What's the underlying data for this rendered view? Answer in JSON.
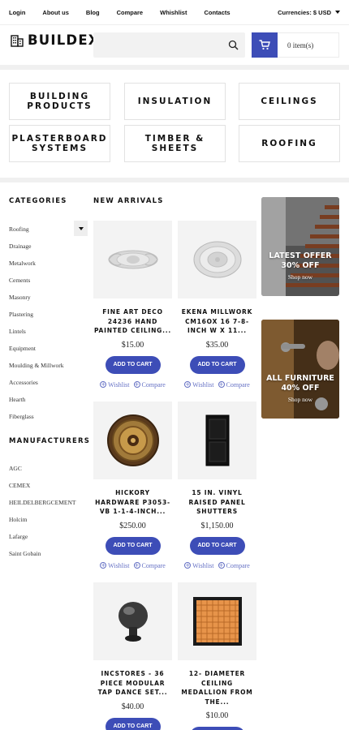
{
  "topbar": {
    "links": [
      "Login",
      "About us",
      "Blog",
      "Compare",
      "Whishlist",
      "Contacts"
    ],
    "currency_label": "Currencies: $ USD"
  },
  "header": {
    "logo_text": "BUILDEX",
    "search_placeholder": "",
    "cart_count": "0 item(s)"
  },
  "top_categories": [
    {
      "line1": "BUILDING",
      "line2": "PRODUCTS"
    },
    {
      "line1": "INSULATION",
      "line2": ""
    },
    {
      "line1": "CEILINGS",
      "line2": ""
    },
    {
      "line1": "PLASTERBOARD",
      "line2": "SYSTEMS"
    },
    {
      "line1": "TIMBER &",
      "line2": "SHEETS"
    },
    {
      "line1": "ROOFING",
      "line2": ""
    }
  ],
  "sidebar": {
    "categories_title": "CATEGORIES",
    "categories": [
      "Roofing",
      "Drainage",
      "Metalwork",
      "Cements",
      "Masonry",
      "Plastering",
      "Lintels",
      "Equipment",
      "Moulding & Millwork",
      "Accessories",
      "Hearth",
      "Fiberglass"
    ],
    "manufacturers_title": "MANUFACTURERS",
    "manufacturers": [
      "AGC",
      "CEMEX",
      "HEILDELBERGCEMENT",
      "Holcim",
      "Lafarge",
      "Saint Gobain"
    ]
  },
  "main": {
    "title": "NEW ARRIVALS",
    "add_label": "ADD TO CART",
    "wishlist_label": "Wishlist",
    "compare_label": "Compare",
    "products": [
      {
        "name": "FINE ART DECO 24236 HAND PAINTED CEILING...",
        "price": "$15.00",
        "icon": "ceiling-medallion-oval"
      },
      {
        "name": "EKENA MILLWORK CM16OX 16 7-8-INCH W X 11...",
        "price": "$35.00",
        "icon": "ceiling-medallion-round"
      },
      {
        "name": "HICKORY HARDWARE P3053-VB 1-1-4-INCH...",
        "price": "$250.00",
        "icon": "ornate-medallion"
      },
      {
        "name": "15 IN. VINYL RAISED PANEL SHUTTERS",
        "price": "$1,150.00",
        "icon": "panel-shutter"
      },
      {
        "name": "INCSTORES - 36 PIECE MODULAR TAP DANCE SET...",
        "price": "$40.00",
        "icon": "cabinet-knob"
      },
      {
        "name": "12- DIAMETER CEILING MEDALLION FROM THE...",
        "price": "$10.00",
        "icon": "woven-tile"
      }
    ]
  },
  "banners": [
    {
      "line1": "LATEST OFFER",
      "line2": "30% OFF",
      "link": "Shop now"
    },
    {
      "line1": "ALL FURNITURE",
      "line2": "40% OFF",
      "link": "Shop now"
    }
  ],
  "colors": {
    "accent": "#3d4db7",
    "link": "#6470c4"
  }
}
